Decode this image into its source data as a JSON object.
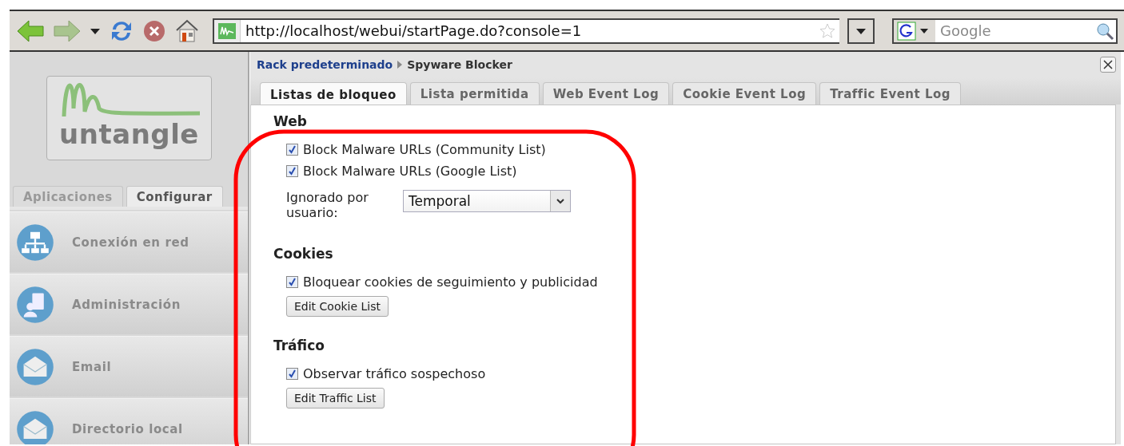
{
  "toolbar": {
    "url": "http://localhost/webui/startPage.do?console=1",
    "search": {
      "placeholder": "Google"
    }
  },
  "sidebar": {
    "logo": "untangle",
    "tabs": [
      {
        "label": "Aplicaciones",
        "selected": false
      },
      {
        "label": "Configurar",
        "selected": true
      }
    ],
    "items": [
      {
        "label": "Conexión en red",
        "kind": "network"
      },
      {
        "label": "Administración",
        "kind": "admin"
      },
      {
        "label": "Email",
        "kind": "email"
      },
      {
        "label": "Directorio local",
        "kind": "email"
      }
    ]
  },
  "panel": {
    "breadcrumb": [
      "Rack predeterminado",
      "Spyware Blocker"
    ],
    "tabs": [
      {
        "label": "Listas de bloqueo",
        "selected": true
      },
      {
        "label": "Lista permitida",
        "selected": false
      },
      {
        "label": "Web Event Log",
        "selected": false
      },
      {
        "label": "Cookie Event Log",
        "selected": false
      },
      {
        "label": "Traffic Event Log",
        "selected": false
      }
    ],
    "sections": [
      {
        "title": "Web",
        "rows": [
          {
            "kind": "checkbox",
            "label": "Block Malware URLs (Community List)",
            "checked": true
          },
          {
            "kind": "checkbox",
            "label": "Block Malware URLs (Google List)",
            "checked": true
          },
          {
            "kind": "select",
            "label": "Ignorado por usuario:",
            "value": "Temporal"
          }
        ]
      },
      {
        "title": "Cookies",
        "rows": [
          {
            "kind": "checkbox",
            "label": "Bloquear cookies de seguimiento y publicidad",
            "checked": true
          },
          {
            "kind": "button",
            "label": "Edit Cookie List"
          }
        ]
      },
      {
        "title": "Tráfico",
        "rows": [
          {
            "kind": "checkbox",
            "label": "Observar tráfico sospechoso",
            "checked": true
          },
          {
            "kind": "button",
            "label": "Edit Traffic List"
          }
        ]
      }
    ]
  }
}
